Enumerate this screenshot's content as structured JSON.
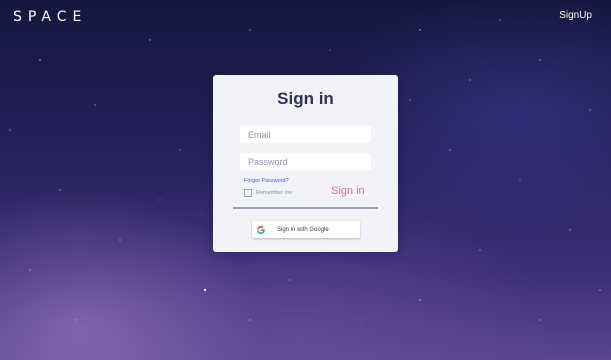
{
  "header": {
    "logo": "SPACE",
    "signup_label": "SignUp"
  },
  "login": {
    "title": "Sign in",
    "email_placeholder": "Email",
    "password_placeholder": "Password",
    "forgot_password": "Forgot Password?",
    "remember_me": "Remember me",
    "signin_label": "Sign in",
    "google_label": "Sign in with Google",
    "google_icon": "google-g-icon"
  },
  "colors": {
    "signin_accent": "#ee6b83",
    "link_accent": "#4b5bd1",
    "title_text": "#2f3254",
    "card_bg": "#f2f3f8"
  }
}
